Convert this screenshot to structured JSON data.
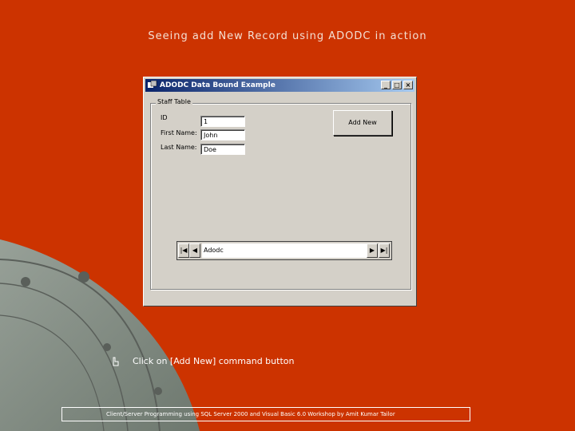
{
  "slide": {
    "title": "Seeing add New Record using ADODC in action",
    "bullet": "Click on [Add New] command button",
    "footer": "Client/Server Programming using SQL Server 2000 and Visual Basic 6.0 Workshop by Amit Kumar Tailor"
  },
  "window": {
    "title": "ADODC Data Bound Example",
    "controls": {
      "minimize": "_",
      "maximize": "□",
      "close": "×"
    },
    "group_label": "Staff Table",
    "fields": [
      {
        "label": "ID",
        "value": "1"
      },
      {
        "label": "First Name:",
        "value": "John"
      },
      {
        "label": "Last Name:",
        "value": "Doe"
      }
    ],
    "add_new_label": "Add New",
    "adodc": {
      "caption": "Adodc",
      "first": "|◀",
      "prev": "◀",
      "next": "▶",
      "last": "▶|"
    }
  },
  "colors": {
    "background": "#cc3300",
    "window_face": "#d4d0c8",
    "titlebar_start": "#0a246a",
    "titlebar_end": "#a6caf0"
  }
}
